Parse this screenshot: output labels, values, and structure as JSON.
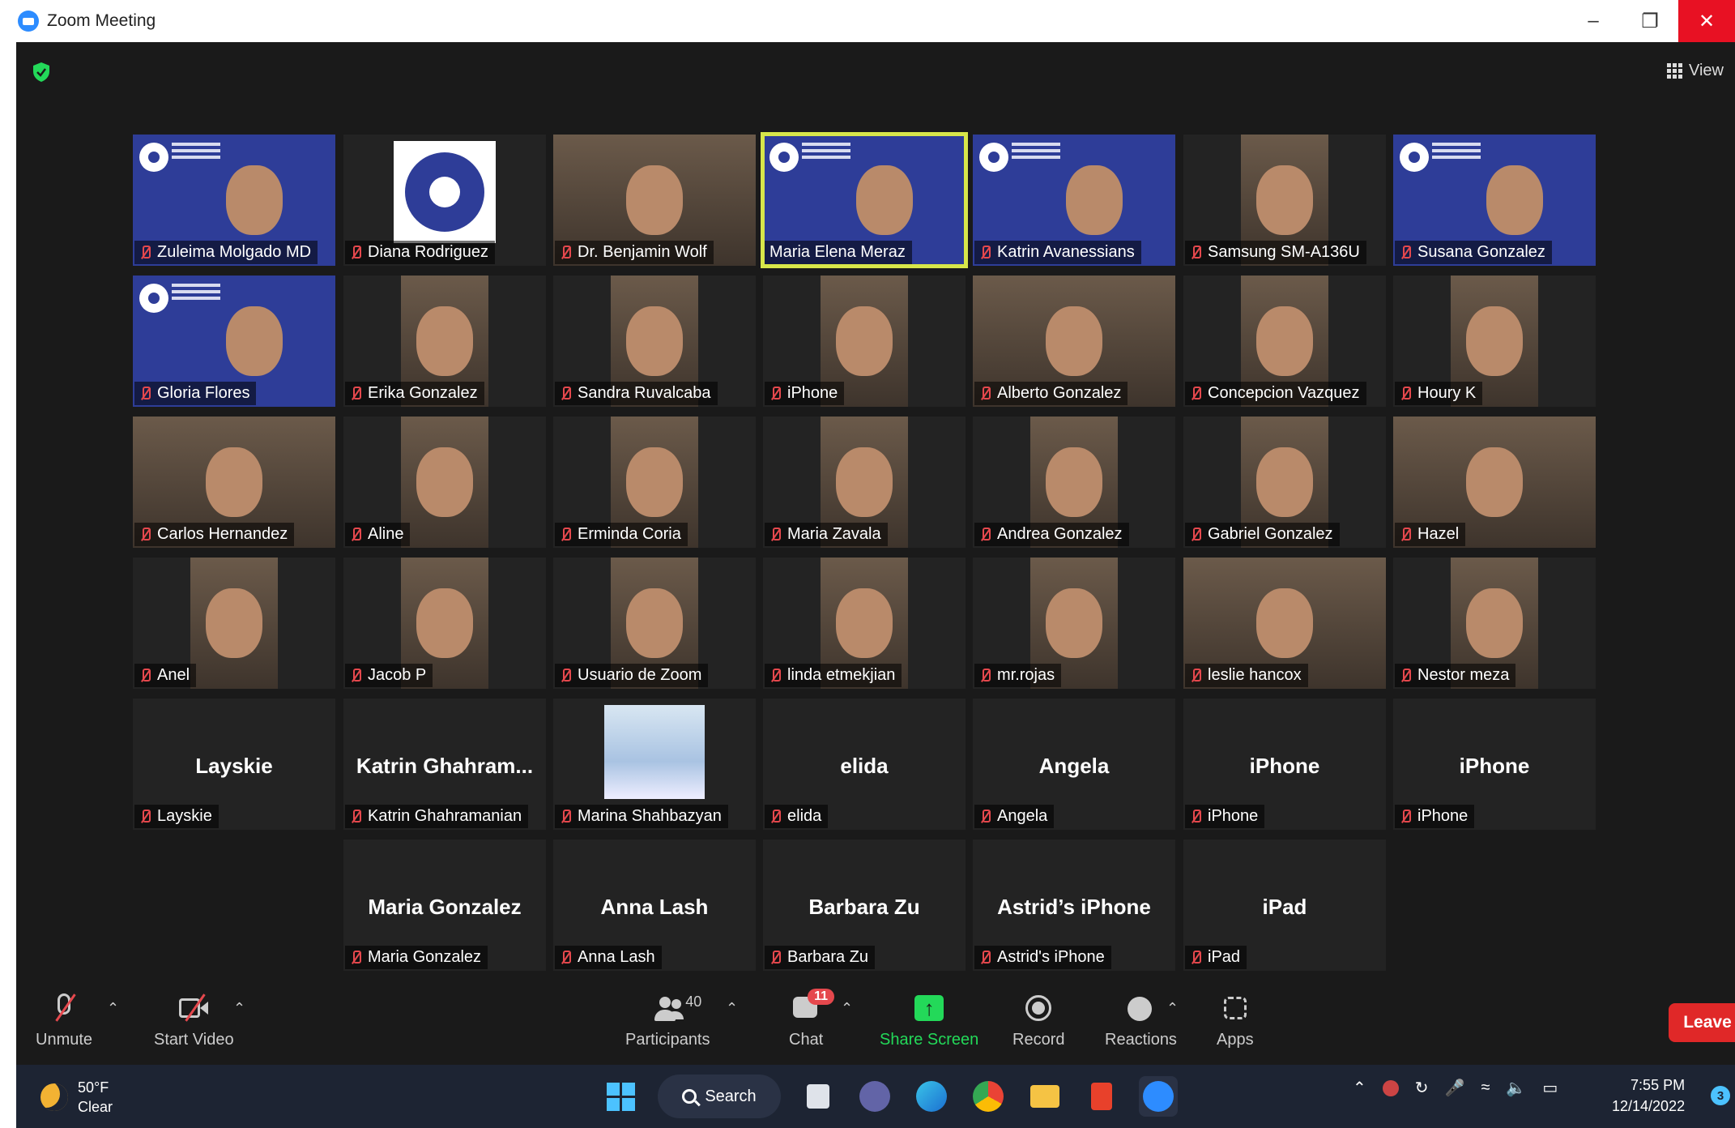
{
  "window": {
    "title": "Zoom Meeting",
    "controls": [
      "minimize",
      "restore",
      "close"
    ]
  },
  "view_label": "View",
  "participants_grid": [
    {
      "name": "Zuleima Molgado MD",
      "type": "pea"
    },
    {
      "name": "Diana Rodriguez",
      "type": "logo"
    },
    {
      "name": "Dr. Benjamin Wolf",
      "type": "video"
    },
    {
      "name": "Maria Elena Meraz",
      "type": "pea",
      "speaking": true,
      "muted": false
    },
    {
      "name": "Katrin Avanessians",
      "type": "pea"
    },
    {
      "name": "Samsung SM-A136U",
      "type": "video-narrow"
    },
    {
      "name": "Susana Gonzalez",
      "type": "pea"
    },
    {
      "name": "Gloria Flores",
      "type": "pea"
    },
    {
      "name": "Erika Gonzalez",
      "type": "video-narrow"
    },
    {
      "name": "Sandra Ruvalcaba",
      "type": "video-narrow"
    },
    {
      "name": "iPhone",
      "type": "video-narrow"
    },
    {
      "name": "Alberto Gonzalez",
      "type": "video"
    },
    {
      "name": "Concepcion Vazquez",
      "type": "video-narrow"
    },
    {
      "name": "Houry K",
      "type": "video-narrow"
    },
    {
      "name": "Carlos Hernandez",
      "type": "video"
    },
    {
      "name": "Aline",
      "type": "video-narrow"
    },
    {
      "name": "Erminda Coria",
      "type": "video-narrow"
    },
    {
      "name": "Maria Zavala",
      "type": "video-narrow"
    },
    {
      "name": "Andrea Gonzalez",
      "type": "video-narrow"
    },
    {
      "name": "Gabriel Gonzalez",
      "type": "video-narrow"
    },
    {
      "name": "Hazel",
      "type": "video"
    },
    {
      "name": "Anel",
      "type": "video-narrow"
    },
    {
      "name": "Jacob P",
      "type": "video-narrow"
    },
    {
      "name": "Usuario de Zoom",
      "type": "video-narrow"
    },
    {
      "name": "linda etmekjian",
      "type": "video-narrow"
    },
    {
      "name": "mr.rojas",
      "type": "video-narrow"
    },
    {
      "name": "leslie hancox",
      "type": "video"
    },
    {
      "name": "Nestor meza",
      "type": "video-narrow"
    },
    {
      "name": "Layskie",
      "display": "Layskie",
      "type": "off"
    },
    {
      "name": "Katrin Ghahramanian",
      "display": "Katrin Ghahram...",
      "type": "off"
    },
    {
      "name": "Marina Shahbazyan",
      "type": "thumb"
    },
    {
      "name": "elida",
      "display": "elida",
      "type": "off"
    },
    {
      "name": "Angela",
      "display": "Angela",
      "type": "off"
    },
    {
      "name": "iPhone",
      "display": "iPhone",
      "type": "off"
    },
    {
      "name": "iPhone",
      "display": "iPhone",
      "type": "off"
    },
    {
      "name": "Maria Gonzalez",
      "display": "Maria Gonzalez",
      "type": "off"
    },
    {
      "name": "Anna Lash",
      "display": "Anna Lash",
      "type": "off"
    },
    {
      "name": "Barbara Zu",
      "display": "Barbara Zu",
      "type": "off"
    },
    {
      "name": "Astrid's iPhone",
      "display": "Astrid’s iPhone",
      "type": "off"
    },
    {
      "name": "iPad",
      "display": "iPad",
      "type": "off"
    }
  ],
  "toolbar": {
    "unmute": "Unmute",
    "start_video": "Start Video",
    "participants": "Participants",
    "participants_count": "40",
    "chat": "Chat",
    "chat_badge": "11",
    "share_screen": "Share Screen",
    "record": "Record",
    "reactions": "Reactions",
    "apps": "Apps",
    "leave": "Leave",
    "share_color": "#23d959",
    "leave_color": "#e02828"
  },
  "taskbar": {
    "temperature": "50°F",
    "condition": "Clear",
    "search": "Search",
    "time": "7:55 PM",
    "date": "12/14/2022",
    "notifications": "3"
  }
}
